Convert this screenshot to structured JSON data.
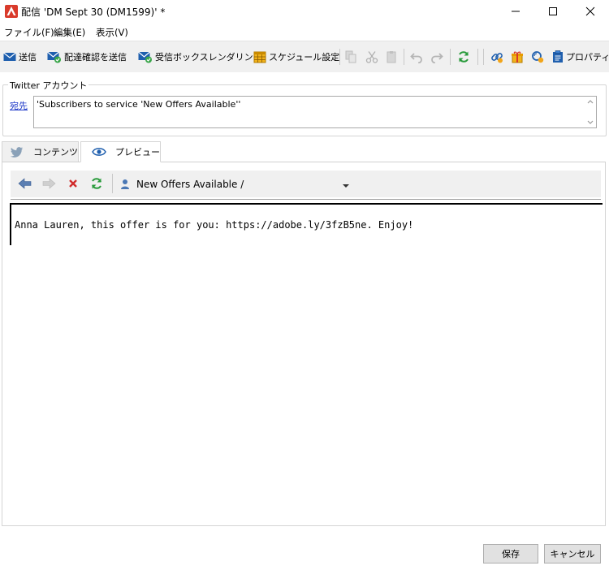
{
  "window": {
    "title": "配信 'DM Sept 30 (DM1599)' *",
    "controls": {
      "minimize": "minimize-icon",
      "maximize": "maximize-icon",
      "close": "close-icon"
    }
  },
  "menu": {
    "items": [
      "ファイル(F)",
      "編集(E)",
      "表示(V)"
    ]
  },
  "toolbar": {
    "send": "送信",
    "send_proof": "配達確認を送信",
    "inbox_rendering": "受信ボックスレンダリング",
    "schedule": "スケジュール設定",
    "properties": "プロパティ"
  },
  "twitter_account": {
    "legend": "Twitter アカウント",
    "to_label": "宛先",
    "to_value": "'Subscribers to service 'New Offers Available''"
  },
  "tabs": {
    "content": "コンテンツ",
    "preview": "プレビュー",
    "active": "preview"
  },
  "preview": {
    "selector_value": "New Offers Available /",
    "message": "Anna Lauren, this offer is for you: https://adobe.ly/3fzB5ne. Enjoy!"
  },
  "footer": {
    "save": "保存",
    "cancel": "キャンセル"
  },
  "colors": {
    "accent_red": "#d93a2b",
    "link_blue": "#1a35c7",
    "toolbar_bg": "#f0f0f0"
  }
}
